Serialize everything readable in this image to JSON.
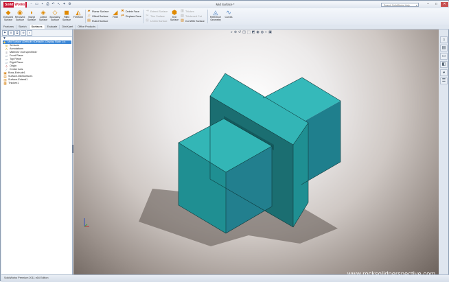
{
  "app": {
    "logo_solid": "Solid",
    "logo_works": "Works",
    "document_title": "Mid Surface *",
    "search_placeholder": "Search SolidWorks Help",
    "quick_access": [
      "new-icon",
      "open-icon",
      "save-icon",
      "print-icon",
      "undo-icon",
      "select-icon",
      "rebuild-icon",
      "options-icon"
    ]
  },
  "window_buttons": [
    "minimize",
    "maximize",
    "close"
  ],
  "ribbon": {
    "large_buttons": [
      {
        "name": "Extruded Surface",
        "icon": "extruded-surface-icon",
        "lines": [
          "Extruded",
          "Surface"
        ]
      },
      {
        "name": "Revolved Surface",
        "icon": "revolved-surface-icon",
        "lines": [
          "Revolved",
          "Surface"
        ]
      },
      {
        "name": "Swept Surface",
        "icon": "swept-surface-icon",
        "lines": [
          "Swept",
          "Surface"
        ]
      },
      {
        "name": "Lofted Surface",
        "icon": "lofted-surface-icon",
        "lines": [
          "Lofted",
          "Surface"
        ]
      },
      {
        "name": "Boundary Surface",
        "icon": "boundary-surface-icon",
        "lines": [
          "Boundary",
          "Surface"
        ]
      },
      {
        "name": "Filled Surface",
        "icon": "filled-surface-icon",
        "lines": [
          "Filled",
          "Surface"
        ]
      },
      {
        "name": "Freeform",
        "icon": "freeform-icon",
        "lines": [
          "Freeform",
          ""
        ]
      }
    ],
    "group1": [
      "Planar Surface",
      "Offset Surface",
      "Ruled Surface"
    ],
    "fillet": {
      "label": "Fillet"
    },
    "group2": [
      "Delete Face",
      "Replace Face"
    ],
    "group3": [
      "Extend Surface",
      "Trim Surface",
      "Untrim Surface"
    ],
    "knit": {
      "lines": [
        "Knit",
        "Surface"
      ]
    },
    "group4": [
      "Thicken",
      "Thickened Cut",
      "Cut With Surface"
    ],
    "reference": {
      "lines": [
        "Reference",
        "Geometry"
      ]
    },
    "curves": {
      "label": "Curves"
    }
  },
  "tabs": [
    "Features",
    "Sketch",
    "Surfaces",
    "Evaluate",
    "DimXpert",
    "Office Products"
  ],
  "active_tab": "Surfaces",
  "tree": {
    "nodes": [
      {
        "label": "Mid Surface  (Default<<Default>_Display State 1>)",
        "icon": "part-icon",
        "root": true
      },
      {
        "label": "Sensors",
        "icon": "sensors-icon"
      },
      {
        "label": "Annotations",
        "icon": "annotations-icon"
      },
      {
        "label": "Material <not specified>",
        "icon": "material-icon"
      },
      {
        "label": "Front Plane",
        "icon": "plane-icon"
      },
      {
        "label": "Top Plane",
        "icon": "plane-icon"
      },
      {
        "label": "Right Plane",
        "icon": "plane-icon"
      },
      {
        "label": "Origin",
        "icon": "origin-icon"
      },
      {
        "label": "Center Axis",
        "icon": "axis-icon"
      },
      {
        "label": "Boss-Extrude1",
        "icon": "extrude-feature-icon"
      },
      {
        "label": "Surface-MidSurface1",
        "icon": "midsurface-feature-icon"
      },
      {
        "label": "Surface-Extend1",
        "icon": "extend-feature-icon"
      },
      {
        "label": "Thicken1",
        "icon": "thicken-feature-icon"
      }
    ]
  },
  "status": {
    "text": "SolidWorks Premium 2011 x64 Edition"
  },
  "watermark": "www.rocksolidperspective.com",
  "colors": {
    "model_top": "#33b6b6",
    "model_front": "#1f8f92",
    "model_right": "#207f8c",
    "model_dark": "#1a6b6e",
    "brand": "#c8102e"
  }
}
